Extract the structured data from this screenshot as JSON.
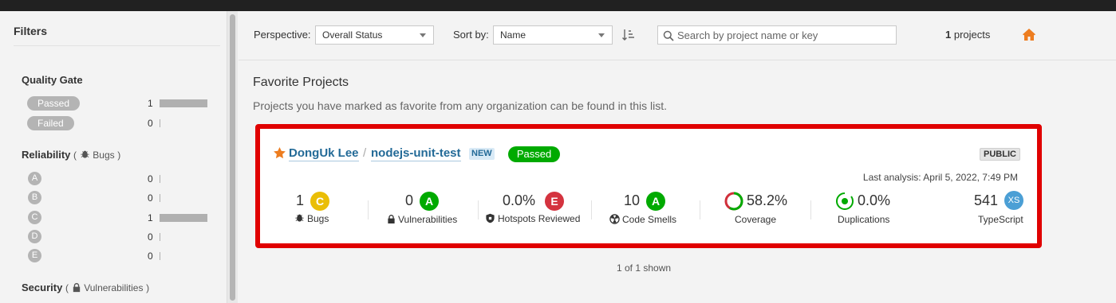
{
  "sidebar": {
    "title": "Filters",
    "quality_gate": {
      "heading": "Quality Gate",
      "items": [
        {
          "label": "Passed",
          "count": "1",
          "fraction": 1.0
        },
        {
          "label": "Failed",
          "count": "0",
          "fraction": 0.0
        }
      ]
    },
    "reliability": {
      "heading": "Reliability",
      "open": "(",
      "sub": "Bugs",
      "close": ")",
      "items": [
        {
          "label": "A",
          "count": "0",
          "fraction": 0.0
        },
        {
          "label": "B",
          "count": "0",
          "fraction": 0.0
        },
        {
          "label": "C",
          "count": "1",
          "fraction": 1.0
        },
        {
          "label": "D",
          "count": "0",
          "fraction": 0.0
        },
        {
          "label": "E",
          "count": "0",
          "fraction": 0.0
        }
      ]
    },
    "security": {
      "heading": "Security",
      "open": "(",
      "sub": "Vulnerabilities",
      "close": ")"
    }
  },
  "toolbar": {
    "perspective_label": "Perspective:",
    "perspective_value": "Overall Status",
    "sort_label": "Sort by:",
    "sort_value": "Name",
    "search_placeholder": "Search by project name or key",
    "count_number": "1",
    "count_text": "projects"
  },
  "main": {
    "heading": "Favorite Projects",
    "description": "Projects you have marked as favorite from any organization can be found in this list.",
    "footer": "1 of 1 shown"
  },
  "project": {
    "organization": "DongUk Lee",
    "separator": "/",
    "name": "nodejs-unit-test",
    "new_badge": "NEW",
    "quality_gate": "Passed",
    "visibility": "PUBLIC",
    "last_analysis": "Last analysis: April 5, 2022, 7:49 PM",
    "measures": {
      "bugs": {
        "value": "1",
        "rating": "C",
        "label": "Bugs"
      },
      "vulnerabilities": {
        "value": "0",
        "rating": "A",
        "label": "Vulnerabilities"
      },
      "hotspots": {
        "value": "0.0%",
        "rating": "E",
        "label": "Hotspots Reviewed"
      },
      "code_smells": {
        "value": "10",
        "rating": "A",
        "label": "Code Smells"
      },
      "coverage": {
        "value": "58.2%",
        "label": "Coverage",
        "fraction": 0.582
      },
      "duplications": {
        "value": "0.0%",
        "label": "Duplications"
      },
      "size": {
        "value": "541",
        "badge": "XS",
        "label": "TypeScript"
      }
    }
  },
  "colors": {
    "rating_A": "#00aa00",
    "rating_C": "#eabe06",
    "rating_E": "#d4333f",
    "link": "#236a97",
    "highlight": "#e00000",
    "home": "#ed7d20",
    "size_badge": "#4b9fd5"
  },
  "icons": [
    "bug-icon",
    "lock-icon",
    "shield-icon",
    "radioactive-icon",
    "star-icon",
    "home-icon",
    "search-icon",
    "sort-icon",
    "chevron-down-icon"
  ]
}
